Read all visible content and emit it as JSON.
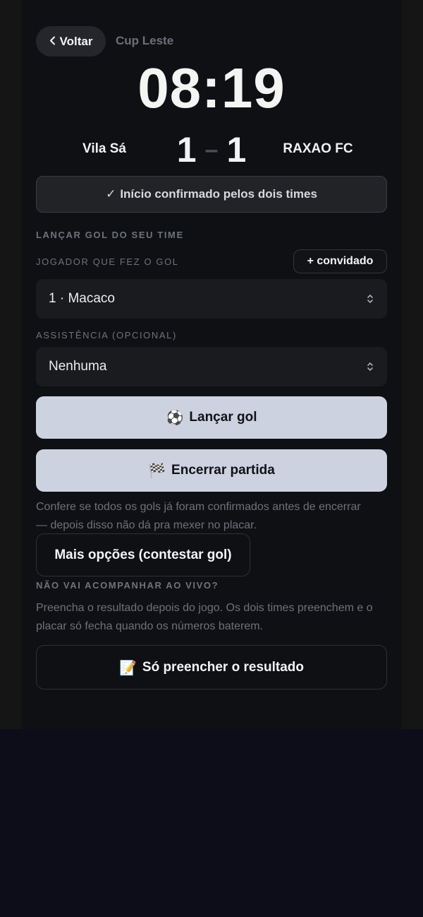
{
  "header": {
    "back_label": "Voltar",
    "back_icon": "chevron-left-icon",
    "competition": "Cup Leste"
  },
  "match": {
    "timer": "08:19",
    "home_team": "Vila Sá",
    "away_team": "RAXAO FC",
    "home_score": "1",
    "away_score": "1",
    "separator": "–"
  },
  "confirmation": {
    "check": "✓",
    "text": "Início confirmado pelos dois times"
  },
  "goal_form": {
    "section_title": "LANÇAR GOL DO SEU TIME",
    "scorer_label": "JOGADOR QUE FEZ O GOL",
    "guest_button": "+ convidado",
    "scorer_value": "1 · Macaco",
    "assist_label": "ASSISTÊNCIA (OPCIONAL)",
    "assist_value": "Nenhuma"
  },
  "actions": {
    "launch_goal_icon": "⚽",
    "launch_goal": "Lançar gol",
    "end_match_icon": "🏁",
    "end_match": "Encerrar partida",
    "end_help": "Confere se todos os gols já foram confirmados antes de encerrar — depois disso não dá pra mexer no placar.",
    "more_options": "Mais opções (contestar gol)"
  },
  "result_only": {
    "section_title": "NÃO VAI ACOMPANHAR AO VIVO?",
    "help": "Preencha o resultado depois do jogo. Os dois times preenchem e o placar só fecha quando os números baterem.",
    "button_icon": "📝",
    "button": "Só preencher o resultado"
  },
  "colors": {
    "background": "#0c0d18",
    "panel": "#0f1013",
    "primary_button": "#cdd2e0",
    "muted_text": "#6e717a"
  }
}
